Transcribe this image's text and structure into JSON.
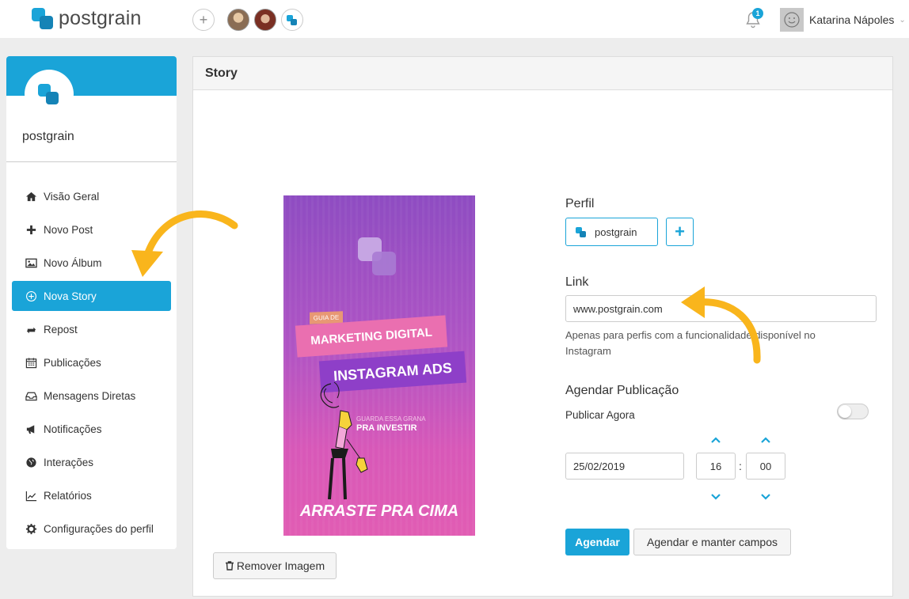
{
  "brand": {
    "name": "postgrain"
  },
  "topbar": {
    "add_account_icon": "plus-icon",
    "notification_count": "1",
    "user_name": "Katarina Nápoles"
  },
  "sidebar": {
    "profile_name": "postgrain",
    "items": [
      {
        "label": "Visão Geral",
        "icon": "home-icon",
        "active": false
      },
      {
        "label": "Novo Post",
        "icon": "plus-icon",
        "active": false
      },
      {
        "label": "Novo Álbum",
        "icon": "image-icon",
        "active": false
      },
      {
        "label": "Nova Story",
        "icon": "plus-circle-icon",
        "active": true
      },
      {
        "label": "Repost",
        "icon": "retweet-icon",
        "active": false
      },
      {
        "label": "Publicações",
        "icon": "calendar-icon",
        "active": false
      },
      {
        "label": "Mensagens Diretas",
        "icon": "inbox-icon",
        "active": false
      },
      {
        "label": "Notificações",
        "icon": "megaphone-icon",
        "active": false
      },
      {
        "label": "Interações",
        "icon": "globe-icon",
        "active": false
      },
      {
        "label": "Relatórios",
        "icon": "line-chart-icon",
        "active": false
      },
      {
        "label": "Configurações do perfil",
        "icon": "gear-icon",
        "active": false
      }
    ]
  },
  "panel": {
    "title": "Story",
    "story_image": {
      "tag": "GUIA DE",
      "line1": "MARKETING DIGITAL",
      "line2": "INSTAGRAM ADS",
      "sub1": "GUARDA ESSA GRANA",
      "sub2": "PRA INVESTIR",
      "cta": "ARRASTE PRA CIMA"
    },
    "remove_image_label": "Remover Imagem",
    "form": {
      "profile_label": "Perfil",
      "profile_chip": "postgrain",
      "link_label": "Link",
      "link_value": "www.postgrain.com",
      "link_help": "Apenas para perfis com a funcionalidade disponível no Instagram",
      "schedule_label": "Agendar Publicação",
      "publish_now_label": "Publicar Agora",
      "publish_now_enabled": false,
      "date_value": "25/02/2019",
      "hour_value": "16",
      "minute_value": "00",
      "time_separator": ":",
      "submit_label": "Agendar",
      "submit_keep_label": "Agendar e manter campos"
    }
  },
  "colors": {
    "accent": "#1aa4d8",
    "arrow": "#f9b51c",
    "background": "#ededed"
  }
}
